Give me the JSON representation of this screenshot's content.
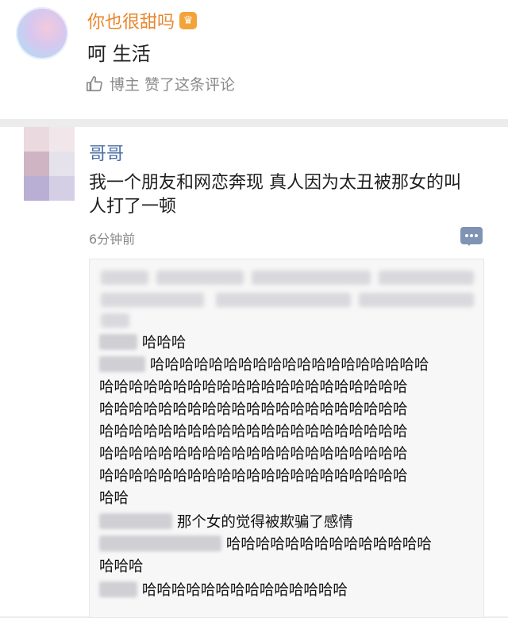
{
  "comment1": {
    "username": "你也很甜吗",
    "badge": "crown-badge",
    "text": "呵 生活",
    "liked_meta": "博主 赞了这条评论"
  },
  "comment2": {
    "username": "哥哥",
    "text": "我一个朋友和网恋奔现 真人因为太丑被那女的叫人打了一顿",
    "time": "6分钟前"
  },
  "screenshot": {
    "lines": [
      {
        "text": "哈哈哈"
      },
      {
        "text": "哈哈哈哈哈哈哈哈哈哈哈哈哈哈哈哈哈哈哈"
      },
      {
        "text": "哈哈哈哈哈哈哈哈哈哈哈哈哈哈哈哈哈哈哈哈哈"
      },
      {
        "text": "哈哈哈哈哈哈哈哈哈哈哈哈哈哈哈哈哈哈哈哈哈"
      },
      {
        "text": "哈哈哈哈哈哈哈哈哈哈哈哈哈哈哈哈哈哈哈哈哈"
      },
      {
        "text": "哈哈哈哈哈哈哈哈哈哈哈哈哈哈哈哈哈哈哈哈哈"
      },
      {
        "text": "哈哈哈哈哈哈哈哈哈哈哈哈哈哈哈哈哈哈哈哈哈"
      },
      {
        "text": "哈哈"
      },
      {
        "text": "那个女的觉得被欺骗了感情"
      },
      {
        "text": "哈哈哈哈哈哈哈哈哈哈哈哈哈哈"
      },
      {
        "text": "哈哈哈"
      },
      {
        "text": "哈哈哈哈哈哈哈哈哈哈哈哈哈哈"
      }
    ]
  },
  "colors": {
    "username_orange": "#e7862d",
    "username_blue": "#4a6fa5",
    "meta_gray": "#8a8a8a"
  }
}
